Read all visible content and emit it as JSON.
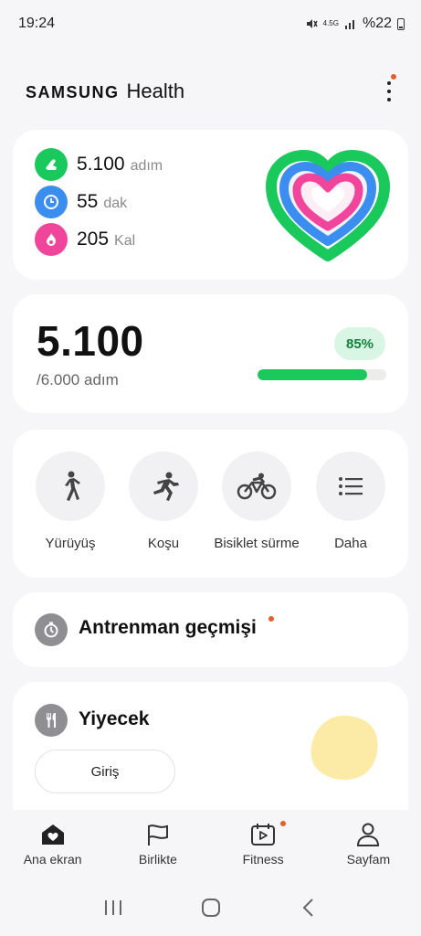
{
  "status": {
    "time": "19:24",
    "network": "4.5G",
    "battery": "%22"
  },
  "header": {
    "brand_samsung": "SAMSUNG",
    "brand_health": "Health"
  },
  "summary": {
    "steps_value": "5.100",
    "steps_unit": "adım",
    "minutes_value": "55",
    "minutes_unit": "dak",
    "calories_value": "205",
    "calories_unit": "Kal"
  },
  "steps_card": {
    "value": "5.100",
    "goal": "/6.000 adım",
    "percent_label": "85%",
    "progress": 0.85
  },
  "activities": [
    {
      "label": "Yürüyüş",
      "icon": "walk-icon"
    },
    {
      "label": "Koşu",
      "icon": "run-icon"
    },
    {
      "label": "Bisiklet sürme",
      "icon": "bike-icon"
    },
    {
      "label": "Daha",
      "icon": "list-icon"
    }
  ],
  "history": {
    "title": "Antrenman geçmişi"
  },
  "food": {
    "title": "Yiyecek",
    "entry_label": "Giriş"
  },
  "nav": [
    {
      "label": "Ana ekran",
      "icon": "home-icon"
    },
    {
      "label": "Birlikte",
      "icon": "flag-icon"
    },
    {
      "label": "Fitness",
      "icon": "fitness-icon"
    },
    {
      "label": "Sayfam",
      "icon": "person-icon"
    }
  ],
  "colors": {
    "steps_green": "#19c95c",
    "minutes_blue": "#3b8ef0",
    "calories_pink": "#f0459a",
    "notification_orange": "#e4602a"
  }
}
